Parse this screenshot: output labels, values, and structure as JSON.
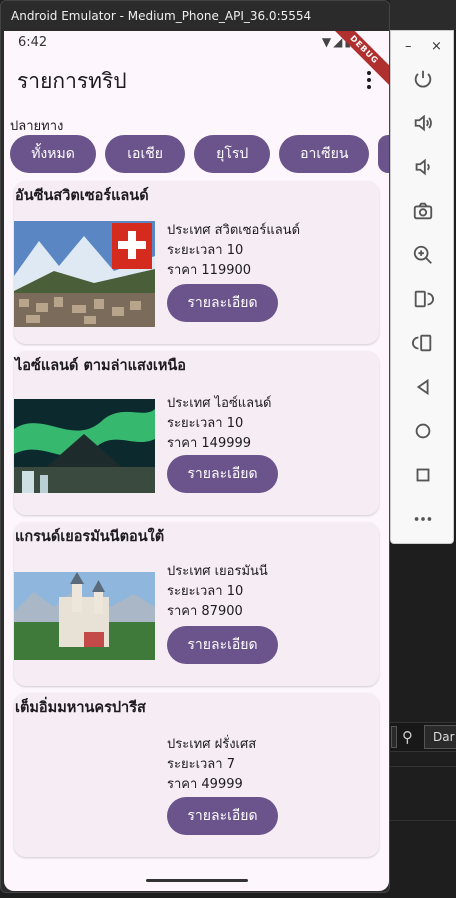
{
  "window": {
    "title": "Android Emulator - Medium_Phone_API_36.0:5554"
  },
  "status_bar": {
    "time": "6:42",
    "debug_banner": "DEBUG"
  },
  "app_bar": {
    "title": "รายการทริป"
  },
  "filter": {
    "label": "ปลายทาง",
    "chips": [
      "ทั้งหมด",
      "เอเชีย",
      "ยุโรป",
      "อาเซียน",
      ""
    ]
  },
  "trips": [
    {
      "title": "อันซีนสวิตเซอร์แลนด์",
      "country": "ประเทศ สวิตเซอร์แลนด์",
      "duration": "ระยะเวลา 10",
      "price": "ราคา 119900",
      "button": "รายละเอียด",
      "image_icon": "swiss-village-image"
    },
    {
      "title": "ไอซ์แลนด์ ตามล่าแสงเหนือ",
      "country": "ประเทศ ไอซ์แลนด์",
      "duration": "ระยะเวลา 10",
      "price": "ราคา 149999",
      "button": "รายละเอียด",
      "image_icon": "aurora-image"
    },
    {
      "title": "แกรนด์เยอรมันนีตอนใต้",
      "country": "ประเทศ เยอรมันนี",
      "duration": "ระยะเวลา 10",
      "price": "ราคา 87900",
      "button": "รายละเอียด",
      "image_icon": "castle-image"
    },
    {
      "title": "เต็มอิ่มมหานครปารีส",
      "country": "ประเทศ ฝรั่งเศส",
      "duration": "ระยะเวลา 7",
      "price": "ราคา 49999",
      "button": "รายละเอียด",
      "image_icon": ""
    }
  ],
  "side_toolbar": {
    "icons": [
      "power-icon",
      "volume-up-icon",
      "volume-down-icon",
      "camera-icon",
      "zoom-icon",
      "rotate-left-icon",
      "rotate-right-icon",
      "back-icon",
      "home-icon",
      "overview-icon",
      "more-icon"
    ]
  },
  "ide": {
    "dropdown_text": "Dar"
  },
  "colors": {
    "accent": "#6b538c",
    "background": "#fdf7fd",
    "card": "#f6edf4"
  }
}
